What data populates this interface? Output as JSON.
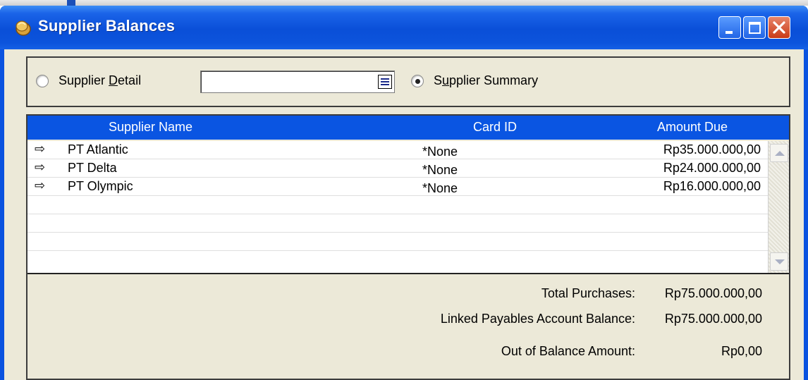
{
  "window": {
    "title": "Supplier Balances",
    "app_icon": "coin-icon",
    "controls": [
      "minimize-icon",
      "maximize-icon",
      "close-icon"
    ]
  },
  "filter": {
    "detail_label": "Supplier Detail",
    "detail_hotkey": "D",
    "detail_selected": false,
    "combo_value": "",
    "summary_label": "Supplier Summary",
    "summary_hotkey": "u",
    "summary_selected": true
  },
  "grid": {
    "columns": [
      "Supplier Name",
      "Card ID",
      "Amount Due"
    ],
    "rows": [
      {
        "name": "PT Atlantic",
        "card_id": "*None",
        "amount": "Rp35.000.000,00"
      },
      {
        "name": "PT Delta",
        "card_id": "*None",
        "amount": "Rp24.000.000,00"
      },
      {
        "name": "PT Olympic",
        "card_id": "*None",
        "amount": "Rp16.000.000,00"
      }
    ],
    "row_icon": "arrow-right-icon"
  },
  "totals": {
    "total_purchases_label": "Total Purchases:",
    "total_purchases_value": "Rp75.000.000,00",
    "linked_label": "Linked Payables Account Balance:",
    "linked_value": "Rp75.000.000,00",
    "oob_label": "Out of Balance Amount:",
    "oob_value": "Rp0,00"
  },
  "colors": {
    "titlebar": "#0a4fd8",
    "header": "#0a55e2",
    "face": "#ece9d8",
    "close": "#c93a16"
  }
}
